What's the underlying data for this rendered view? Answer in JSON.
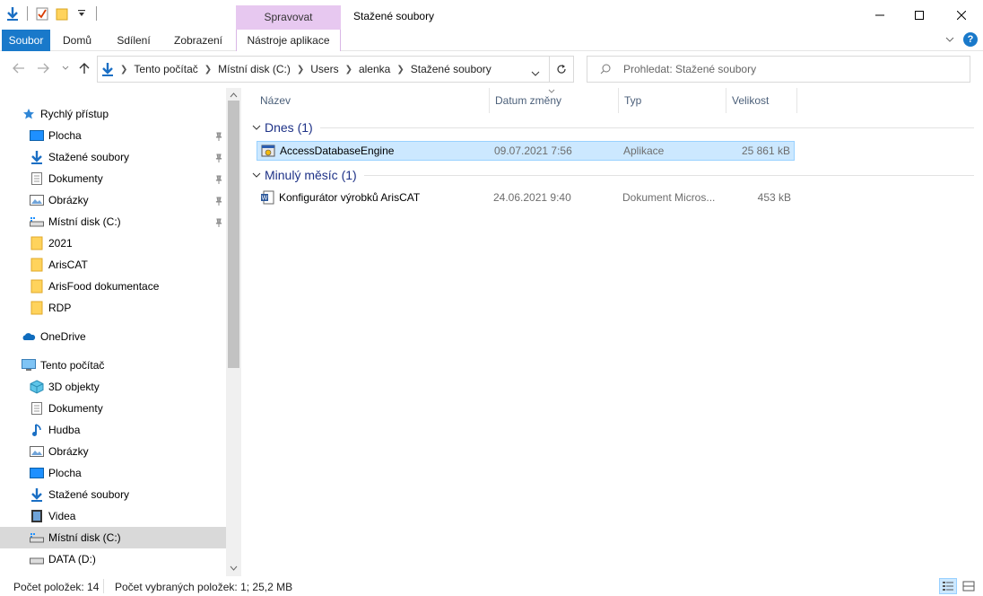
{
  "window": {
    "title": "Stažené soubory"
  },
  "context_tab": {
    "header": "Spravovat",
    "label": "Nástroje aplikace"
  },
  "ribbon": {
    "tabs": [
      "Soubor",
      "Domů",
      "Sdílení",
      "Zobrazení"
    ]
  },
  "navigation": {
    "breadcrumb": [
      "Tento počítač",
      "Místní disk (C:)",
      "Users",
      "alenka",
      "Stažené soubory"
    ],
    "search_placeholder": "Prohledat: Stažené soubory"
  },
  "sidebar": {
    "quick_access": {
      "label": "Rychlý přístup",
      "items": [
        {
          "label": "Plocha",
          "icon": "desktop-icon",
          "pinned": true
        },
        {
          "label": "Stažené soubory",
          "icon": "download-icon",
          "pinned": true
        },
        {
          "label": "Dokumenty",
          "icon": "documents-icon",
          "pinned": true
        },
        {
          "label": "Obrázky",
          "icon": "pictures-icon",
          "pinned": true
        },
        {
          "label": "Místní disk (C:)",
          "icon": "drive-icon",
          "pinned": true
        },
        {
          "label": "2021",
          "icon": "folder-icon",
          "pinned": false
        },
        {
          "label": "ArisCAT",
          "icon": "folder-icon",
          "pinned": false
        },
        {
          "label": "ArisFood dokumentace",
          "icon": "folder-icon",
          "pinned": false
        },
        {
          "label": "RDP",
          "icon": "folder-icon",
          "pinned": false
        }
      ]
    },
    "onedrive": {
      "label": "OneDrive"
    },
    "this_pc": {
      "label": "Tento počítač",
      "items": [
        {
          "label": "3D objekty",
          "icon": "3d-objects-icon"
        },
        {
          "label": "Dokumenty",
          "icon": "documents-icon"
        },
        {
          "label": "Hudba",
          "icon": "music-icon"
        },
        {
          "label": "Obrázky",
          "icon": "pictures-icon"
        },
        {
          "label": "Plocha",
          "icon": "desktop-icon"
        },
        {
          "label": "Stažené soubory",
          "icon": "download-icon"
        },
        {
          "label": "Videa",
          "icon": "videos-icon"
        },
        {
          "label": "Místní disk (C:)",
          "icon": "drive-icon",
          "selected": true
        },
        {
          "label": "DATA (D:)",
          "icon": "drive-icon"
        }
      ]
    }
  },
  "columns": [
    "Název",
    "Datum změny",
    "Typ",
    "Velikost"
  ],
  "groups": [
    {
      "label": "Dnes (1)",
      "files": [
        {
          "name": "AccessDatabaseEngine",
          "date": "09.07.2021 7:56",
          "type": "Aplikace",
          "size": "25 861 kB",
          "selected": true,
          "icon": "installer-icon"
        }
      ]
    },
    {
      "label": "Minulý měsíc (1)",
      "files": [
        {
          "name": "Konfigurátor výrobků ArisCAT",
          "date": "24.06.2021 9:40",
          "type": "Dokument Micros...",
          "size": "453 kB",
          "selected": false,
          "icon": "word-document-icon"
        }
      ]
    }
  ],
  "status": {
    "item_count": "Počet položek: 14",
    "selected_info": "Počet vybraných položek: 1; 25,2 MB"
  },
  "colors": {
    "accent": "#1979ca",
    "selection": "#cce8ff",
    "group_header": "#1e3287"
  }
}
